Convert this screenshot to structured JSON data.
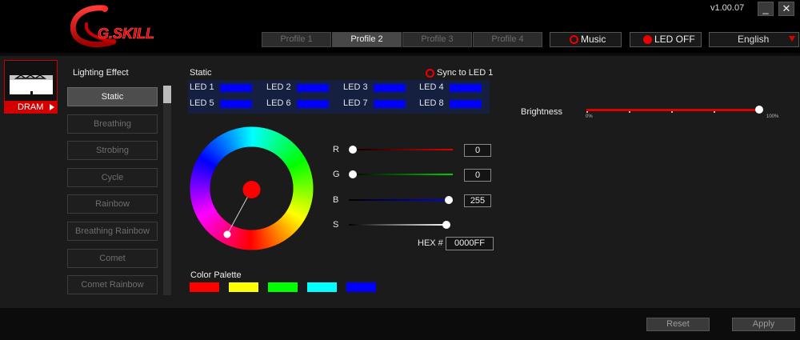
{
  "header": {
    "version": "v1.00.07",
    "minimize_glyph": "_",
    "close_glyph": "✕",
    "profiles": [
      "Profile 1",
      "Profile 2",
      "Profile 3",
      "Profile 4"
    ],
    "active_profile": "Profile 2",
    "music_label": "Music",
    "led_off_label": "LED OFF",
    "language": "English"
  },
  "device": {
    "label": "DRAM",
    "icon": "dram-module-icon"
  },
  "lighting": {
    "title": "Lighting Effect",
    "effects": [
      "Static",
      "Breathing",
      "Strobing",
      "Cycle",
      "Rainbow",
      "Breathing Rainbow",
      "Comet",
      "Comet Rainbow"
    ],
    "active_effect": "Static"
  },
  "static": {
    "title": "Static",
    "sync_label": "Sync to LED 1",
    "leds": [
      {
        "label": "LED 1",
        "color": "#0000ff"
      },
      {
        "label": "LED 2",
        "color": "#0000ff"
      },
      {
        "label": "LED 3",
        "color": "#0000ff"
      },
      {
        "label": "LED 4",
        "color": "#0000ff"
      },
      {
        "label": "LED 5",
        "color": "#0000ff"
      },
      {
        "label": "LED 6",
        "color": "#0000ff"
      },
      {
        "label": "LED 7",
        "color": "#0000ff"
      },
      {
        "label": "LED 8",
        "color": "#0000ff"
      }
    ]
  },
  "color": {
    "r_label": "R",
    "g_label": "G",
    "b_label": "B",
    "s_label": "S",
    "r_value": "0",
    "g_value": "0",
    "b_value": "255",
    "r_level": 0,
    "g_level": 0,
    "b_level": 1,
    "s_level": 1,
    "hex_label": "HEX #",
    "hex_value": "0000FF",
    "selected_color": "#ff0000"
  },
  "palette": {
    "title": "Color Palette",
    "colors": [
      "#ff0000",
      "#ffff00",
      "#00ff00",
      "#00ffff",
      "#0000ff"
    ]
  },
  "brightness": {
    "label": "Brightness",
    "min_label": "0%",
    "max_label": "100%",
    "level": 1
  },
  "footer": {
    "reset_label": "Reset",
    "apply_label": "Apply"
  },
  "colors": {
    "accent": "#dd0000",
    "panel": "#1b1b1b",
    "led_grid": "#152041"
  },
  "logo_text": "G.SKILL"
}
